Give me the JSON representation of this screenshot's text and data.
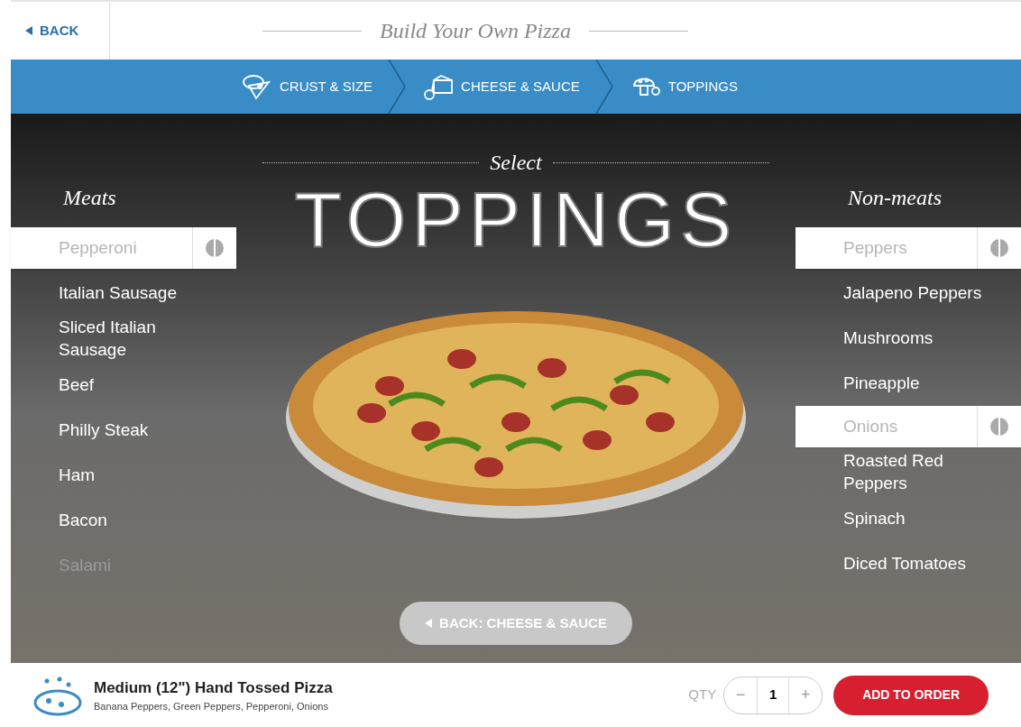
{
  "header": {
    "back": "BACK",
    "title": "Build Your Own Pizza"
  },
  "steps": [
    {
      "label": "CRUST & SIZE",
      "kind": "crust"
    },
    {
      "label": "CHEESE & SAUCE",
      "kind": "cheese"
    },
    {
      "label": "TOPPINGS",
      "kind": "toppings"
    }
  ],
  "hero": {
    "kicker": "Select",
    "title": "TOPPINGS"
  },
  "meats": {
    "heading": "Meats",
    "items": [
      {
        "name": "Pepperoni",
        "selected": true,
        "faded": false
      },
      {
        "name": "Italian Sausage",
        "selected": false,
        "faded": false
      },
      {
        "name": "Sliced Italian Sausage",
        "selected": false,
        "faded": false
      },
      {
        "name": "Beef",
        "selected": false,
        "faded": false
      },
      {
        "name": "Philly Steak",
        "selected": false,
        "faded": false
      },
      {
        "name": "Ham",
        "selected": false,
        "faded": false
      },
      {
        "name": "Bacon",
        "selected": false,
        "faded": false
      },
      {
        "name": "Salami",
        "selected": false,
        "faded": true
      }
    ]
  },
  "nonmeats": {
    "heading": "Non-meats",
    "items": [
      {
        "name": "Peppers",
        "selected": true,
        "faded": false
      },
      {
        "name": "Jalapeno Peppers",
        "selected": false,
        "faded": false
      },
      {
        "name": "Mushrooms",
        "selected": false,
        "faded": false
      },
      {
        "name": "Pineapple",
        "selected": false,
        "faded": false
      },
      {
        "name": "Onions",
        "selected": true,
        "faded": false
      },
      {
        "name": "Roasted Red Peppers",
        "selected": false,
        "faded": false
      },
      {
        "name": "Spinach",
        "selected": false,
        "faded": false
      },
      {
        "name": "Diced Tomatoes",
        "selected": false,
        "faded": false
      }
    ]
  },
  "back_step": "BACK: CHEESE & SAUCE",
  "order": {
    "title": "Medium (12\") Hand Tossed Pizza",
    "toppings": "Banana Peppers, Green Peppers, Pepperoni, Onions",
    "qty_label": "QTY",
    "minus": "−",
    "qty": "1",
    "plus": "+",
    "add": "ADD TO ORDER"
  }
}
